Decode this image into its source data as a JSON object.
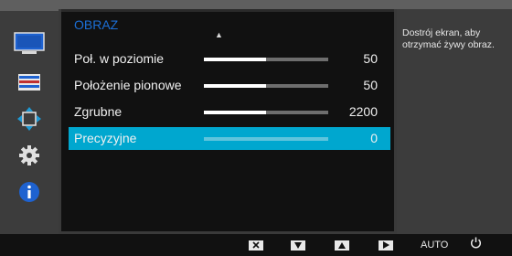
{
  "colors": {
    "accent": "#00a7cf",
    "title": "#1c6fd6"
  },
  "sidebar": {
    "icons": [
      {
        "name": "monitor-icon"
      },
      {
        "name": "color-bars-icon"
      },
      {
        "name": "position-arrows-icon"
      },
      {
        "name": "gear-icon"
      },
      {
        "name": "info-icon"
      }
    ]
  },
  "menu": {
    "title": "OBRAZ",
    "items": [
      {
        "label": "Poł. w poziomie",
        "value": "50",
        "level": 0.5
      },
      {
        "label": "Położenie pionowe",
        "value": "50",
        "level": 0.5
      },
      {
        "label": "Zgrubne",
        "value": "2200",
        "level": 0.5
      },
      {
        "label": "Precyzyjne",
        "value": "0",
        "level": 0.0,
        "selected": true
      }
    ]
  },
  "help": {
    "text": "Dostrój ekran, aby otrzymać żywy obraz."
  },
  "bottom_bar": {
    "buttons": [
      {
        "name": "close-button",
        "icon": "close-icon"
      },
      {
        "name": "down-button",
        "icon": "triangle-down-icon"
      },
      {
        "name": "up-button",
        "icon": "triangle-up-icon"
      },
      {
        "name": "enter-button",
        "icon": "triangle-right-icon"
      },
      {
        "name": "auto-button",
        "label": "AUTO"
      },
      {
        "name": "power-button",
        "icon": "power-icon"
      }
    ]
  }
}
